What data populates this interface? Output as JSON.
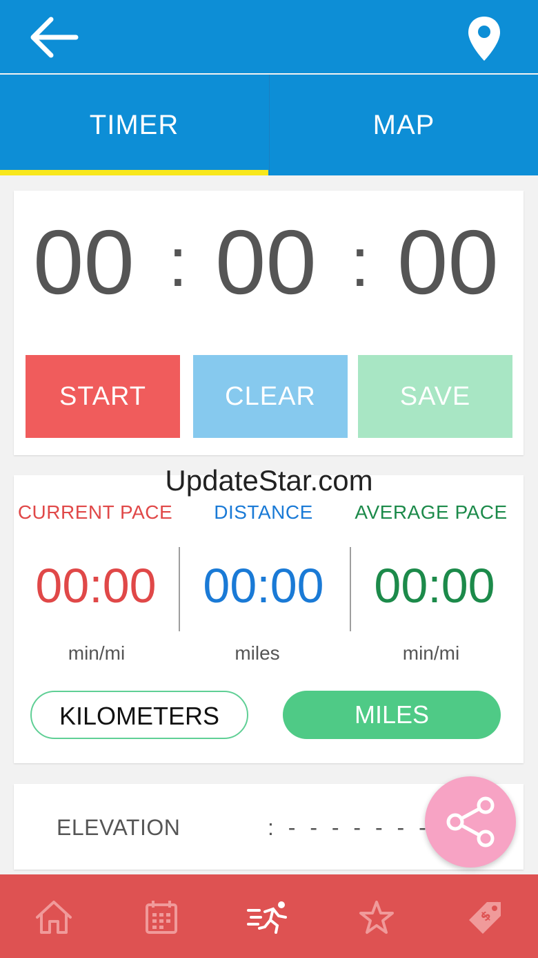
{
  "timer": {
    "hours": "00",
    "minutes": "00",
    "seconds": "00",
    "separator": ":"
  },
  "tabs": [
    {
      "label": "TIMER",
      "active": true
    },
    {
      "label": "MAP",
      "active": false
    }
  ],
  "buttons": {
    "start": "START",
    "clear": "CLEAR",
    "save": "SAVE"
  },
  "watermark": "UpdateStar.com",
  "stats": [
    {
      "label": "CURRENT PACE",
      "value": "00:00",
      "unit": "min/mi",
      "color": "#e04848"
    },
    {
      "label": "DISTANCE",
      "value": "00:00",
      "unit": "miles",
      "color": "#1a7ad6"
    },
    {
      "label": "AVERAGE PACE",
      "value": "00:00",
      "unit": "min/mi",
      "color": "#1c8a4a"
    }
  ],
  "units": {
    "kilometers": "KILOMETERS",
    "miles": "MILES",
    "selected": "MILES"
  },
  "elevation": {
    "label": "ELEVATION",
    "value": ":  - - - - - - -"
  },
  "icons": {
    "back": "back-arrow-icon",
    "location": "location-pin-icon",
    "share": "share-icon",
    "nav": [
      "home-icon",
      "calendar-icon",
      "runner-icon",
      "star-icon",
      "tag-icon"
    ]
  },
  "colors": {
    "primary": "#0d8ed6",
    "tab_indicator": "#f8e71c",
    "start": "#f05c5c",
    "clear": "#86c9ee",
    "save": "#a8e6c4",
    "miles_active": "#4fca86",
    "share_fab": "#f7a3c4",
    "bottom_nav": "#de5252"
  }
}
